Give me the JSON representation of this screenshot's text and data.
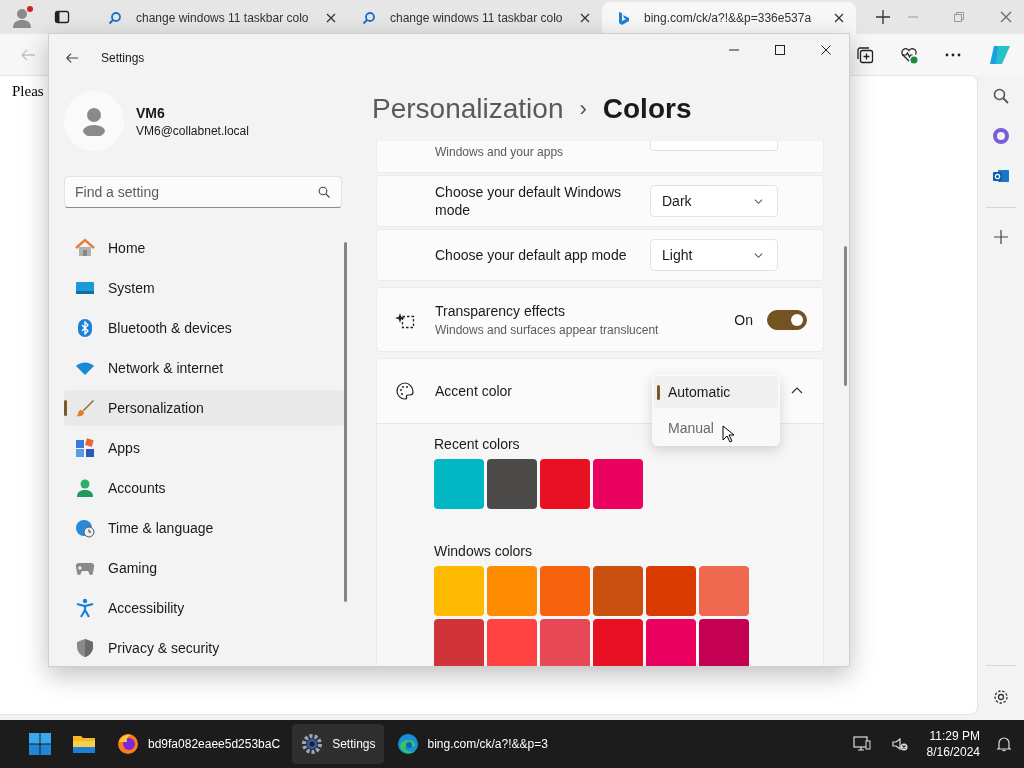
{
  "browser": {
    "tabs": [
      {
        "title": "change windows 11 taskbar colo",
        "kind": "search",
        "selected": false
      },
      {
        "title": "change windows 11 taskbar colo",
        "kind": "search",
        "selected": false
      },
      {
        "title": "bing.com/ck/a?!&&p=336e537a",
        "kind": "bing",
        "selected": true
      }
    ],
    "page_text": "Pleas"
  },
  "settings": {
    "window_title": "Settings",
    "user": {
      "name": "VM6",
      "email": "VM6@collabnet.local"
    },
    "search": {
      "placeholder": "Find a setting"
    },
    "nav": [
      {
        "label": "Home",
        "kind": "home",
        "selected": false
      },
      {
        "label": "System",
        "kind": "system",
        "selected": false
      },
      {
        "label": "Bluetooth & devices",
        "kind": "bluetooth",
        "selected": false
      },
      {
        "label": "Network & internet",
        "kind": "network",
        "selected": false
      },
      {
        "label": "Personalization",
        "kind": "brush",
        "selected": true
      },
      {
        "label": "Apps",
        "kind": "apps",
        "selected": false
      },
      {
        "label": "Accounts",
        "kind": "accounts",
        "selected": false
      },
      {
        "label": "Time & language",
        "kind": "time",
        "selected": false
      },
      {
        "label": "Gaming",
        "kind": "gaming",
        "selected": false
      },
      {
        "label": "Accessibility",
        "kind": "accessibility",
        "selected": false
      },
      {
        "label": "Privacy & security",
        "kind": "privacy",
        "selected": false
      }
    ],
    "breadcrumb": {
      "parent": "Personalization",
      "separator": "›",
      "current": "Colors"
    },
    "cut_row": {
      "description": "Windows and your apps"
    },
    "mode_rows": [
      {
        "label": "Choose your default Windows mode",
        "value": "Dark"
      },
      {
        "label": "Choose your default app mode",
        "value": "Light"
      }
    ],
    "transparency": {
      "title": "Transparency effects",
      "description": "Windows and surfaces appear translucent",
      "state_label": "On",
      "on": true
    },
    "accent": {
      "title": "Accent color",
      "expanded": true,
      "menu": [
        {
          "label": "Automatic",
          "selected": true
        },
        {
          "label": "Manual",
          "selected": false
        }
      ],
      "recent_label": "Recent colors",
      "recent": [
        {
          "color": "#00b7c3"
        },
        {
          "color": "#4c4a48"
        },
        {
          "color": "#e81123"
        },
        {
          "color": "#ea005e"
        }
      ],
      "windows_label": "Windows colors",
      "windows_colors": [
        {
          "color": "#ffb900"
        },
        {
          "color": "#ff8c00"
        },
        {
          "color": "#f7630c"
        },
        {
          "color": "#ca5010"
        },
        {
          "color": "#da3b01"
        },
        {
          "color": "#ef6950"
        },
        {
          "color": "#d13438"
        },
        {
          "color": "#ff4343"
        },
        {
          "color": "#e74856"
        },
        {
          "color": "#e81123"
        },
        {
          "color": "#ea005e"
        },
        {
          "color": "#c30052"
        }
      ]
    }
  },
  "taskbar": {
    "apps": [
      {
        "kind": "start",
        "selected": false
      },
      {
        "kind": "explorer",
        "selected": false
      },
      {
        "kind": "firefox",
        "label": "bd9fa082eaee5d253baC",
        "selected": false
      },
      {
        "kind": "settings",
        "label": "Settings",
        "selected": true
      },
      {
        "kind": "edge",
        "label": "bing.com/ck/a?!&&p=3",
        "selected": false
      }
    ],
    "time": "11:29 PM",
    "date": "8/16/2024"
  }
}
